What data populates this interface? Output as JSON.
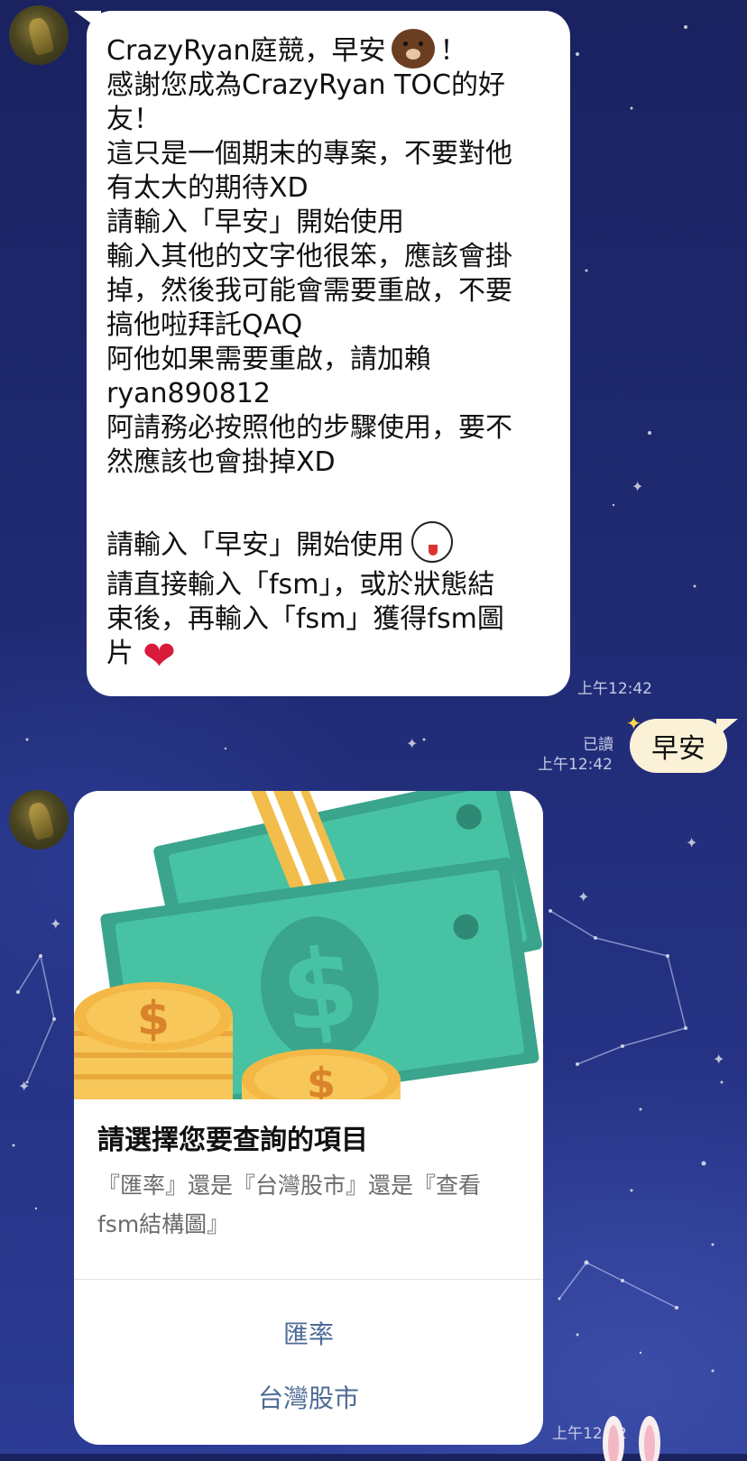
{
  "chat": {
    "incoming_message": {
      "lines": [
        "CrazyRyan庭競，早安",
        "感謝您成為CrazyRyan TOC的好",
        "友！",
        "這只是一個期末的專案，不要對他",
        "有太大的期待XD",
        "請輸入「早安」開始使用",
        "輸入其他的文字他很笨，應該會掛",
        "掉，然後我可能會需要重啟，不要",
        "搞他啦拜託QAQ",
        "阿他如果需要重啟，請加賴",
        "ryan890812",
        "阿請務必按照他的步驟使用，要不",
        "然應該也會掛掉XD",
        "",
        "請輸入「早安」開始使用",
        "請直接輸入「fsm」，或於狀態結",
        "束後，再輸入「fsm」獲得fsm圖",
        "片"
      ],
      "greeting_suffix": "！",
      "timestamp": "上午12:42"
    },
    "outgoing_message": {
      "text": "早安",
      "read_label": "已讀",
      "timestamp": "上午12:42"
    },
    "card": {
      "title": "請選擇您要查詢的項目",
      "description": "『匯率』還是『台灣股市』還是『查看fsm結構圖』",
      "buttons": [
        "匯率",
        "台灣股市"
      ],
      "timestamp": "上午12:42"
    }
  },
  "icons": {
    "greeting_emoji": "brown-bear-emoji",
    "start_emoji": "wink-face-emoji",
    "end_emoji": "heart-emoji",
    "hero_image": "money-bills-and-coins-illustration"
  },
  "colors": {
    "bubble_out": "#fbf1d6",
    "card_button": "#4c6b95",
    "background": "#1f2a72"
  }
}
